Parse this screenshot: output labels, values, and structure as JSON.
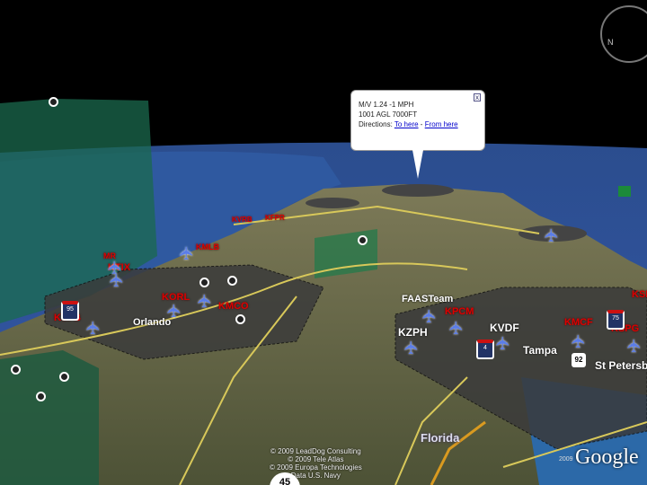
{
  "popup": {
    "line1": "M/V 1.24 -1 MPH",
    "line2": "1001 AGL 7000FT",
    "directions": "Directions:",
    "to_here": "To here",
    "sep": "-",
    "from_here": "From here",
    "close": "x"
  },
  "airports": [
    "KVRB",
    "KFPR",
    "KMLB",
    "MR",
    "KTIX",
    "KORL",
    "KMCO",
    "KSFB",
    "FAASTeam",
    "KPCM",
    "KZPH",
    "KMCF",
    "KSPG",
    "KSK"
  ],
  "places": {
    "orlando": "Orlando",
    "kvdf": "KVDF",
    "tampa": "Tampa",
    "st_petersburg": "St Petersb",
    "florida": "Florida"
  },
  "highways": {
    "i95": "95",
    "i4": "4",
    "i75": "75",
    "us92": "92"
  },
  "credits": [
    "© 2009 LeadDog Consulting",
    "© 2009 Tele Atlas",
    "© 2009 Europa Technologies",
    "Data U.S. Navy"
  ],
  "google": {
    "logo": "Google",
    "year": "2009"
  },
  "zoom_dial": "45",
  "compass": {
    "north": "N"
  }
}
